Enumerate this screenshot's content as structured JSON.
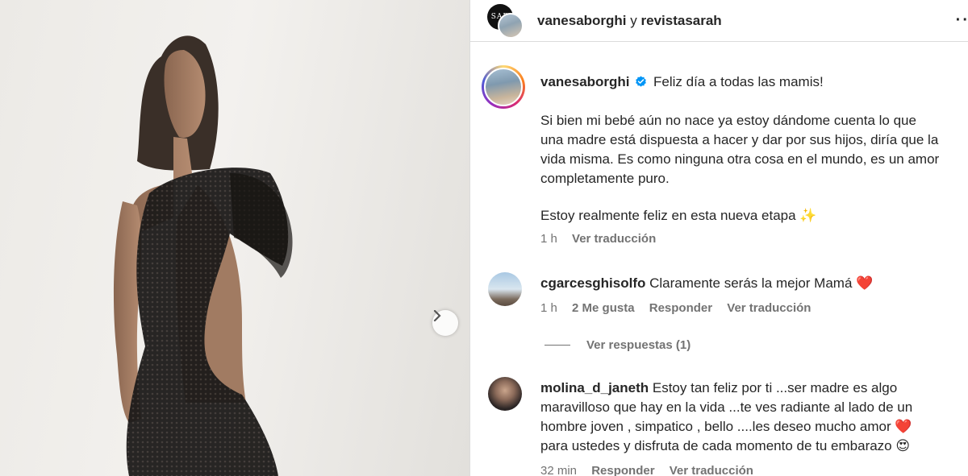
{
  "header": {
    "avatar_text": "SAR",
    "user1": "vanesaborghi",
    "joiner": " y ",
    "user2": "revistasarah",
    "more_glyph": "··"
  },
  "caption": {
    "username": "vanesaborghi",
    "first_line": "Feliz día a todas las mamis!",
    "paragraph_lines": [
      "Si bien mi bebé aún no nace ya estoy dándome cuenta lo que",
      "una madre está dispuesta a hacer y dar por sus hijos, diría que la",
      "vida misma. Es como ninguna otra cosa en el mundo, es un amor",
      "completamente puro."
    ],
    "last_line": "Estoy realmente feliz en esta nueva etapa ✨",
    "time": "1 h",
    "translate": "Ver traducción"
  },
  "comments": [
    {
      "username": "cgarcesghisolfo",
      "lines": [
        "Claramente serás la mejor Mamá ❤️"
      ],
      "time": "1 h",
      "likes": "2 Me gusta",
      "reply": "Responder",
      "translate": "Ver traducción",
      "view_replies": "Ver respuestas (1)"
    },
    {
      "username": "molina_d_janeth",
      "lines": [
        "Estoy tan feliz por ti ...ser madre es algo",
        "maravilloso que hay en la vida ...te ves radiante al lado de un",
        "hombre joven , simpatico , bello ....les deseo mucho amor ❤️",
        "para ustedes y disfruta de cada momento de tu embarazo 😍"
      ],
      "time": "32 min",
      "reply": "Responder",
      "translate": "Ver traducción"
    }
  ],
  "colors": {
    "verified_blue": "#0095f6",
    "secondary_text": "#737373",
    "primary_text": "#262626"
  },
  "icons": {
    "next": "chevron-right-icon",
    "verified": "verified-badge-icon"
  }
}
